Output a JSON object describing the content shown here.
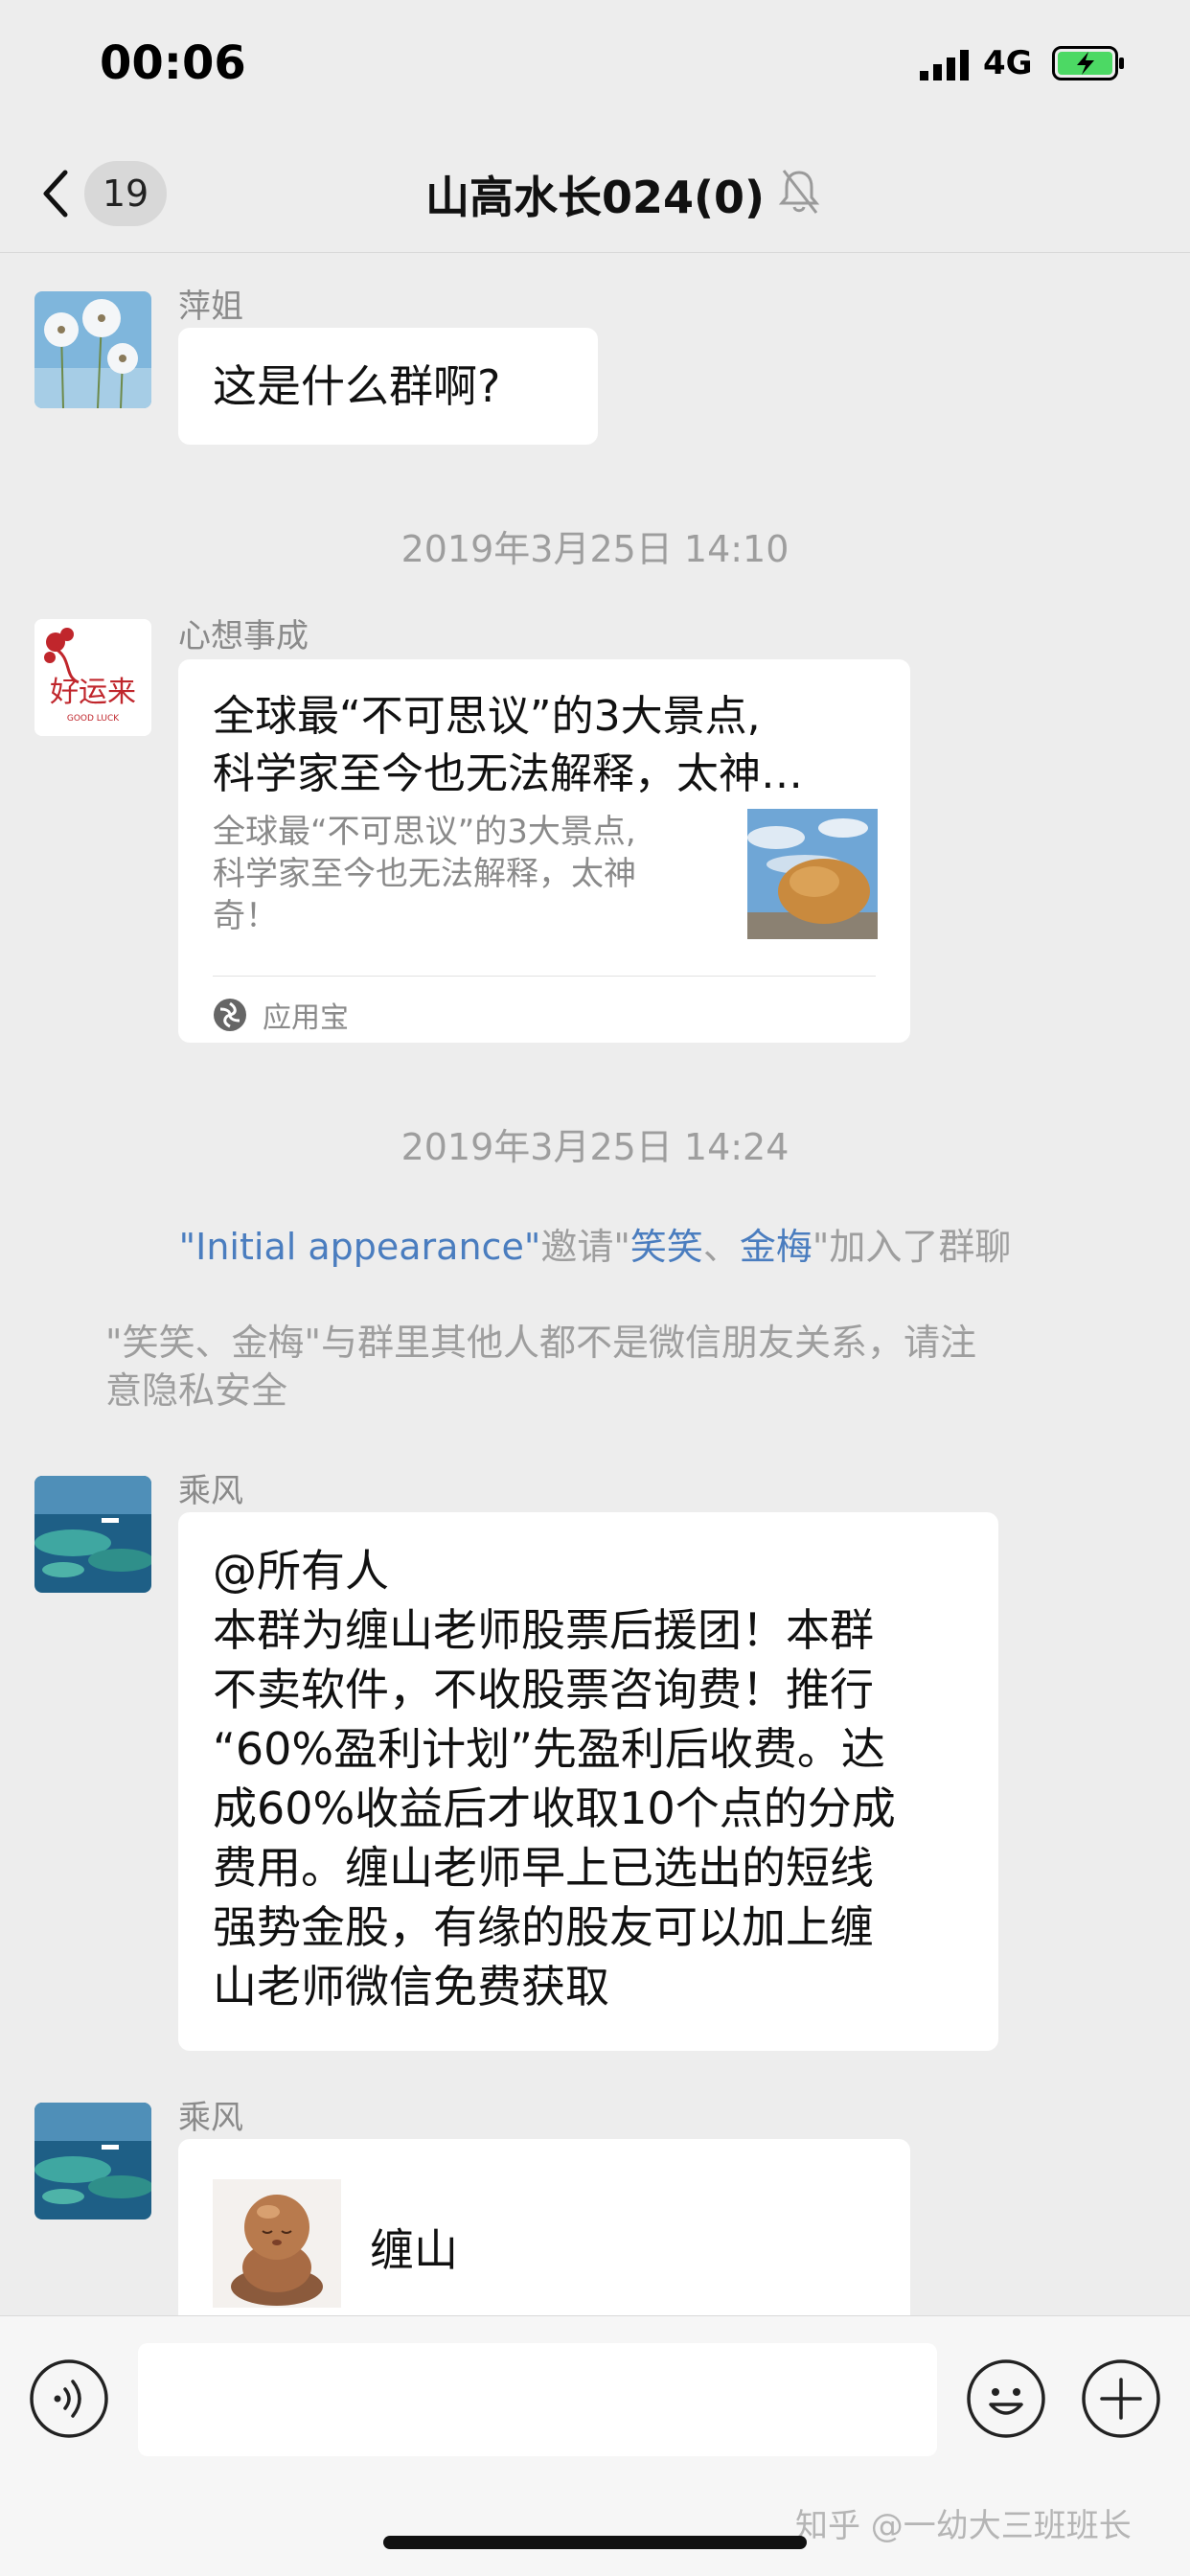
{
  "status_bar": {
    "time": "00:06",
    "network": "4G"
  },
  "nav": {
    "unread_count": "19",
    "title": "山高水长024(0)"
  },
  "messages": [
    {
      "sender": "萍姐",
      "text": "这是什么群啊?"
    },
    {
      "sender": "心想事成",
      "card": {
        "title": "全球最“不可思议”的3大景点,科学家至今也无法解释，太神…",
        "title_line1": "全球最“不可思议”的3大景点,",
        "title_line2": "科学家至今也无法解释，太神…",
        "desc_line1": "全球最“不可思议”的3大景点,",
        "desc_line2": "科学家至今也无法解释，太神",
        "desc_line3": "奇！",
        "source": "应用宝"
      },
      "avatar_text": "好运来",
      "avatar_sub": "GOOD LUCK"
    },
    {
      "sender": "乘风",
      "lines": [
        "@所有人",
        "本群为缠山老师股票后援团！本群",
        "不卖软件，不收股票咨询费！推行",
        "“60%盈利计划”先盈利后收费。达",
        "成60%收益后才收取10个点的分成",
        "费用。缠山老师早上已选出的短线",
        "强势金股，有缘的股友可以加上缠",
        "山老师微信免费获取"
      ]
    },
    {
      "sender": "乘风",
      "contact_name": "缠山"
    }
  ],
  "timestamps": [
    "2019年3月25日 14:10",
    "2019年3月25日 14:24"
  ],
  "system": {
    "inviter": "\"Initial appearance\"",
    "invite_word": "邀请\"",
    "invitee1": "笑笑",
    "sep": "、",
    "invitee2": "金梅",
    "joined": "\"加入了群聊",
    "notice_line1": "\"笑笑、金梅\"与群里其他人都不是微信朋友关系，请注",
    "notice_line2": "意隐私安全"
  },
  "watermark": "知乎 @一幼大三班班长",
  "colors": {
    "background": "#ededed",
    "bubble": "#ffffff",
    "link": "#4a7dbf",
    "battery": "#4cd964"
  }
}
